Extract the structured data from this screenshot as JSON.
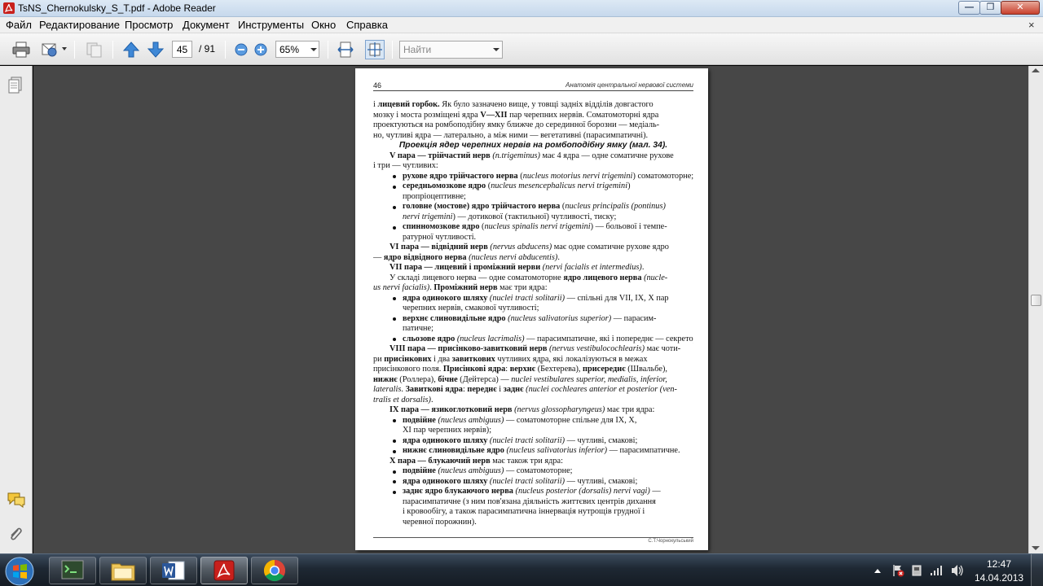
{
  "window": {
    "title": "TsNS_Chernokulsky_S_T.pdf - Adobe Reader",
    "minimize_label": "—",
    "maximize_label": "❐",
    "close_label": "✕"
  },
  "menubar": {
    "items": [
      "Файл",
      "Редактирование",
      "Просмотр",
      "Документ",
      "Инструменты",
      "Окно",
      "Справка"
    ],
    "close_label": "×"
  },
  "toolbar": {
    "page_number": "45",
    "page_total": "/ 91",
    "zoom": "65%",
    "find_placeholder": "Найти"
  },
  "document": {
    "page_number": "46",
    "running_header": "Анатомія центральної нервової системи",
    "footer": "С.Т.Чорнокульський",
    "lines": [
      {
        "kind": "p",
        "html": "і <b>лицевий горбок.</b> Як було зазначено вище, у товщі задніх відділів довгастого"
      },
      {
        "kind": "p",
        "html": "мозку і моста розміщені ядра <b>V—XII</b> пар черепних нервів. Соматомоторні ядра"
      },
      {
        "kind": "p",
        "html": "проектуються на ромбоподібну ямку ближче до серединної борозни — медіаль-"
      },
      {
        "kind": "p",
        "html": "но, чутливі ядра — латерально, а між ними — вегетативні (парасимпатичні)."
      },
      {
        "kind": "hd",
        "html": "Проекція ядер черепних нервів на ромбоподібну ямку (мал. 34)."
      },
      {
        "kind": "ind",
        "html": "<b>V пара — трійчастий нерв</b> <i>(n.trigeminus)</i> має 4 ядра — одне соматичне рухове"
      },
      {
        "kind": "p",
        "html": "і три — чутливих:"
      },
      {
        "kind": "bl",
        "html": "<b>рухове ядро трійчастого нерва</b> (<i>nucleus motorius nervi trigemini</i>) соматомоторне;"
      },
      {
        "kind": "bl",
        "html": "<b>середньомозкове ядро</b> (<i>nucleus mesencephalicus nervi trigemini</i>)"
      },
      {
        "kind": "blc",
        "html": "пропріоцептивне;"
      },
      {
        "kind": "bl",
        "html": "<b>головне (мостове) ядро трійчастого нерва</b> (<i>nucleus principalis (pontinus)</i>"
      },
      {
        "kind": "blc",
        "html": "<i>nervi trigemini</i>) — дотикової (тактильної) чутливості, тиску;"
      },
      {
        "kind": "bl",
        "html": "<b>спинномозкове ядро</b> (<i>nucleus spinalis nervi trigemini</i>) — больової і темпе-"
      },
      {
        "kind": "blc",
        "html": "ратурної чутливості."
      },
      {
        "kind": "ind",
        "html": "<b>VI пара — відвідний нерв</b> <i>(nervus abducens)</i> має одне соматичне рухове ядро"
      },
      {
        "kind": "p",
        "html": "— <b>ядро відвідного нерва</b> <i>(nucleus nervi abducentis)</i>."
      },
      {
        "kind": "ind",
        "html": "<b>VII пара — лицевий і проміжний нерви</b> <i>(nervi facialis et intermedius)</i>."
      },
      {
        "kind": "ind",
        "html": "У складі лицевого нерва — одне соматомоторне <b>ядро лицевого нерва</b> <i>(nucle-</i>"
      },
      {
        "kind": "p",
        "html": "<i>us nervi facialis)</i>. <b>Проміжний нерв</b> має три ядра:"
      },
      {
        "kind": "bl",
        "html": "<b>ядра одинокого шляху</b> <i>(nuclei tracti solitarii)</i> — спільні для VII, IX, X пар"
      },
      {
        "kind": "blc",
        "html": "черепних нервів, смакової чутливості;"
      },
      {
        "kind": "bl",
        "html": "<b>верхнє слиновидільне ядро</b> <i>(nucleus salivatorius superior)</i> — парасим-"
      },
      {
        "kind": "blc",
        "html": "патичне;"
      },
      {
        "kind": "bl",
        "html": "<b>сльозове ядро</b> <i>(nucleus lacrimalis)</i> — парасимпатичне, які і попереднє — секреторне."
      },
      {
        "kind": "ind",
        "html": "<b>VIII пара — присінково-завитковий нерв</b> <i>(nervus vestibulocochlearis)</i> має чоти-"
      },
      {
        "kind": "p",
        "html": "ри <b>присінкових</b> і два <b>завиткових</b> чутливих ядра, які локалізуються в межах"
      },
      {
        "kind": "p",
        "html": "присінкового поля. <b>Присінкові ядра</b>: <b>верхнє</b> (Бехтерева), <b>присереднє</b> (Швальбе),"
      },
      {
        "kind": "p",
        "html": "<b>нижнє</b> (Роллера), <b>бічне</b> (Дейтерса) — <i>nuclei vestibulares superior, medialis, inferior,</i>"
      },
      {
        "kind": "p",
        "html": "<i>lateralis</i>. <b>Завиткові ядра</b>: <b>переднє</b> і <b>заднє</b> <i>(nuclei cochleares anterior et posterior (ven-</i>"
      },
      {
        "kind": "p",
        "html": "<i>tralis et dorsalis)</i>."
      },
      {
        "kind": "ind",
        "html": "<b>IX пара — язикоглотковий нерв</b> <i>(nervus glossopharyngeus)</i> має три ядра:"
      },
      {
        "kind": "bl",
        "html": "<b>подвійне</b> <i>(nucleus ambiguus)</i> — соматомоторне спільне для IX, X,"
      },
      {
        "kind": "blc",
        "html": "XI пар черепних нервів);"
      },
      {
        "kind": "bl",
        "html": "<b>ядра одинокого шляху</b> <i>(nuclei tracti solitarii)</i> — чутливі, смакові;"
      },
      {
        "kind": "bl",
        "html": "<b>нижнє слиновидільне ядро</b> <i>(nucleus salivatorius inferior)</i> — парасимпатичне."
      },
      {
        "kind": "ind",
        "html": "<b>X пара — блукаючий нерв</b> має також три ядра:"
      },
      {
        "kind": "bl",
        "html": "<b>подвійне</b> <i>(nucleus ambiguus)</i> — соматомоторне;"
      },
      {
        "kind": "bl",
        "html": "<b>ядра одинокого шляху</b> <i>(nuclei tracti solitarii)</i> — чутливі, смакові;"
      },
      {
        "kind": "bl",
        "html": "<b>заднє ядро блукаючого нерва</b> <i>(nucleus posterior (dorsalis) nervi vagi)</i> —"
      },
      {
        "kind": "blc",
        "html": "парасимпатичне (з ним пов'язана діяльність життєвих центрів дихання"
      },
      {
        "kind": "blc",
        "html": "і кровообігу, а також парасимпатична іннервація нутрощів грудної і"
      },
      {
        "kind": "blc",
        "html": "черевної порожнин)."
      }
    ]
  },
  "taskbar": {
    "clock_time": "12:47",
    "clock_date": "14.04.2013"
  },
  "colors": {
    "viewer_bg": "#474747",
    "taskbar": "#1e2833",
    "pdf_red": "#c8201c"
  }
}
